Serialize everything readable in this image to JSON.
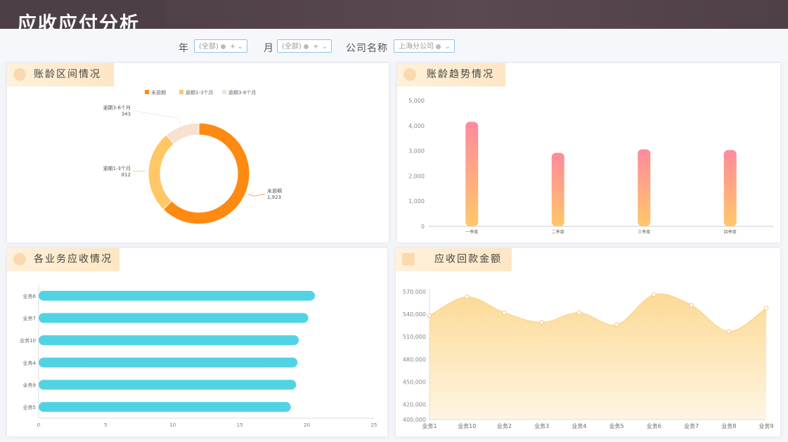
{
  "page": {
    "title": "应收应付分析"
  },
  "filters": {
    "year_label": "年",
    "year_value": "(全部)",
    "month_label": "月",
    "month_value": "(全部)",
    "company_label": "公司名称",
    "company_value": "上海分公司"
  },
  "panels": {
    "aging": {
      "title": "账龄区间情况"
    },
    "trend": {
      "title": "账龄趋势情况"
    },
    "business": {
      "title": "各业务应收情况"
    },
    "payback": {
      "title": "应收回款金额"
    }
  },
  "colors": {
    "accent_orange": "#ff8a11",
    "accent_yellow": "#ffc766",
    "accent_beige": "#f7e1cf",
    "bar_pink": "#ff8a9c",
    "bar_gold": "#ffc86a",
    "bar_cyan": "#52d3e4",
    "area": "#fcd890"
  },
  "chart_data": [
    {
      "type": "pie",
      "legend": [
        "未逾期",
        "逾期1-3个月",
        "逾期3-6个月"
      ],
      "slices": [
        {
          "label": "未逾期",
          "value": 1923,
          "value_text": "1,923",
          "color": "#ff8a11"
        },
        {
          "label": "逾期1-3个月",
          "value": 812,
          "value_text": "812",
          "color": "#ffc766"
        },
        {
          "label": "逾期3-6个月",
          "value": 343,
          "value_text": "343",
          "color": "#f7e1cf"
        }
      ],
      "legend_position": "top-center"
    },
    {
      "type": "bar",
      "categories": [
        "一季度",
        "二季度",
        "三季度",
        "四季度"
      ],
      "values": [
        4150,
        2920,
        3060,
        3030
      ],
      "ylim": [
        0,
        5000
      ],
      "yticks": [
        "0",
        "1,000",
        "2,000",
        "3,000",
        "4,000",
        "5,000"
      ],
      "grid": false
    },
    {
      "type": "bar",
      "orientation": "horizontal",
      "categories": [
        "业务6",
        "业务7",
        "业务10",
        "业务4",
        "业务9",
        "业务5"
      ],
      "values": [
        20.6,
        20.1,
        19.4,
        19.3,
        19.2,
        18.8
      ],
      "xlim": [
        0,
        25
      ],
      "xticks": [
        "0",
        "5",
        "10",
        "15",
        "20",
        "25"
      ]
    },
    {
      "type": "area",
      "categories": [
        "业务1",
        "业务10",
        "业务2",
        "业务3",
        "业务4",
        "业务5",
        "业务6",
        "业务7",
        "业务8",
        "业务9"
      ],
      "values": [
        538000,
        563000,
        542000,
        529000,
        542000,
        526000,
        566000,
        552000,
        517000,
        548000
      ],
      "ylim": [
        400000,
        570000
      ],
      "yticks": [
        "400,000",
        "420,000",
        "450,000",
        "480,000",
        "510,000",
        "540,000",
        "570,000"
      ]
    }
  ]
}
